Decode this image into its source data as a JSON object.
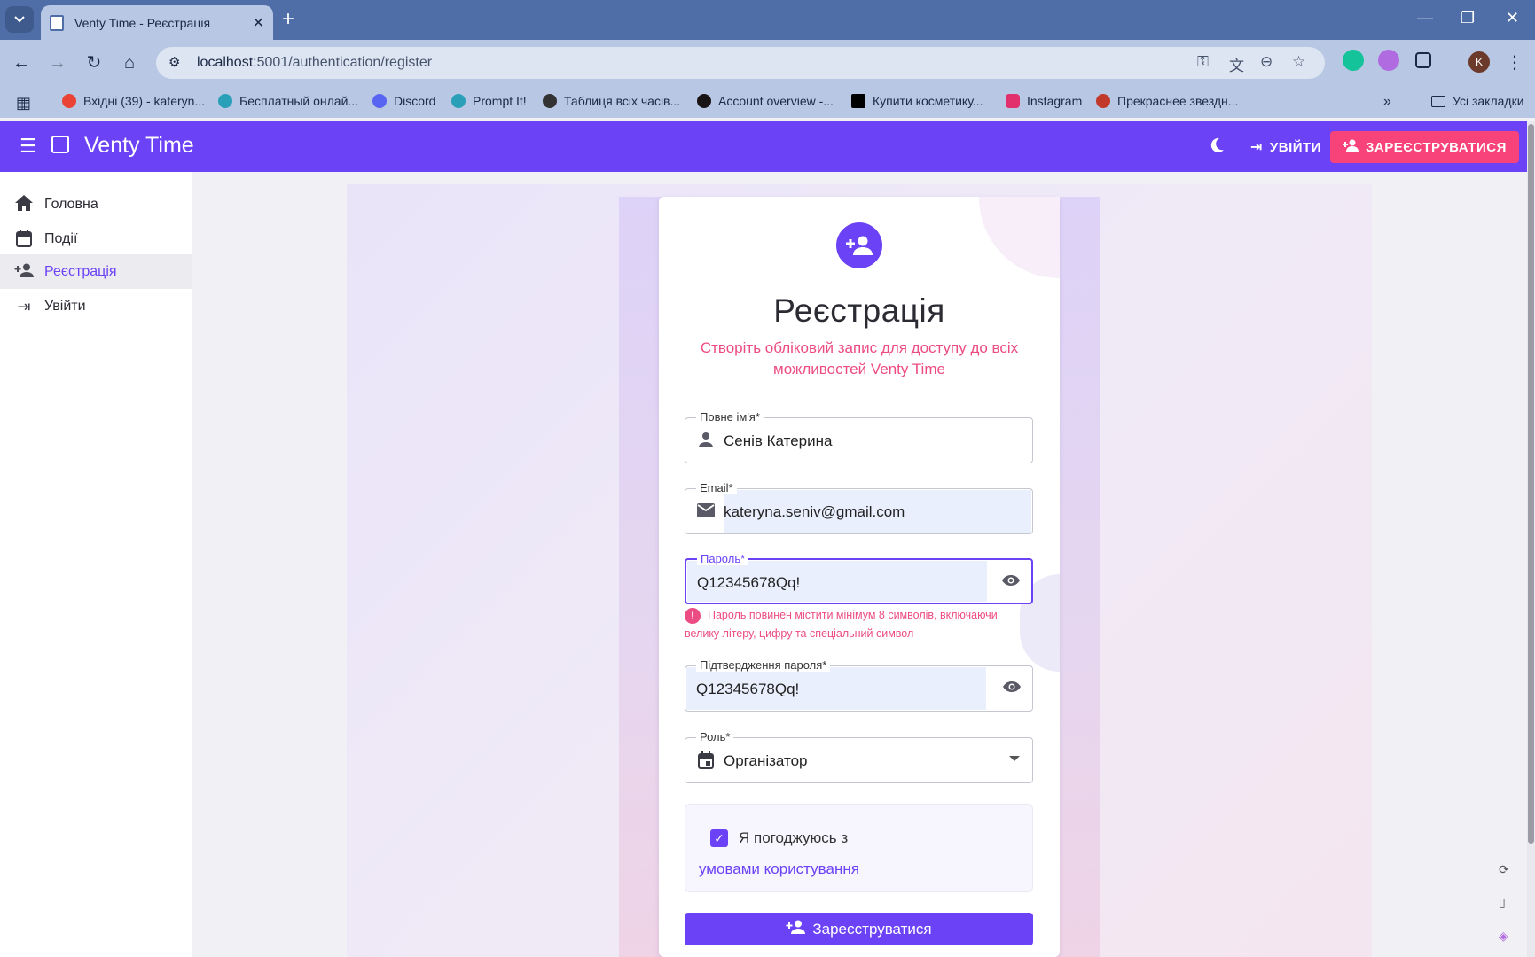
{
  "browser": {
    "tab_title": "Venty Time - Реєстрація",
    "url_host": "localhost",
    "url_path": ":5001/authentication/register",
    "bookmarks": [
      {
        "label": "Вхідні (39) - kateryn...",
        "color": "#ea4335"
      },
      {
        "label": "Бесплатный онлай...",
        "color": "#2aa0b8"
      },
      {
        "label": "Discord",
        "color": "#5865f2"
      },
      {
        "label": "Prompt It!",
        "color": "#2aa0b8"
      },
      {
        "label": "Таблиця всіх часів...",
        "color": "#333333"
      },
      {
        "label": "Account overview -...",
        "color": "#191414"
      },
      {
        "label": "Купити косметику...",
        "color": "#000000"
      },
      {
        "label": "Instagram",
        "color": "#e1306c"
      },
      {
        "label": "Прекраснее звездн...",
        "color": "#c0392b"
      }
    ],
    "all_bookmarks": "Усі закладки",
    "profile_initial": "K"
  },
  "header": {
    "brand": "Venty Time",
    "login_label": "УВІЙТИ",
    "register_label": "ЗАРЕЄСТРУВАТИСЯ",
    "accent": "#6b42f5",
    "register_color": "#f8437a"
  },
  "sidebar": {
    "items": [
      {
        "label": "Головна",
        "icon": "home-icon"
      },
      {
        "label": "Події",
        "icon": "calendar-icon"
      },
      {
        "label": "Реєстрація",
        "icon": "person-add-icon",
        "active": true
      },
      {
        "label": "Увійти",
        "icon": "login-icon"
      }
    ]
  },
  "form": {
    "title": "Реєстрація",
    "subtitle": "Створіть обліковий запис для доступу до всіх можливостей Venty Time",
    "full_name": {
      "label": "Повне ім'я*",
      "value": "Сенів Катерина"
    },
    "email": {
      "label": "Email*",
      "value": "kateryna.seniv@gmail.com"
    },
    "password": {
      "label": "Пароль*",
      "value": "Q12345678Qq!"
    },
    "password_error": "Пароль повинен містити мінімум 8 символів, включаючи велику літеру, цифру та спеціальний символ",
    "confirm_password": {
      "label": "Підтвердження пароля*",
      "value": "Q12345678Qq!"
    },
    "role": {
      "label": "Роль*",
      "value": "Організатор"
    },
    "agree_text": "Я погоджуюсь з",
    "terms_link": "умовами користування",
    "submit_label": "Зареєструватися",
    "error_color": "#ec4c84"
  }
}
